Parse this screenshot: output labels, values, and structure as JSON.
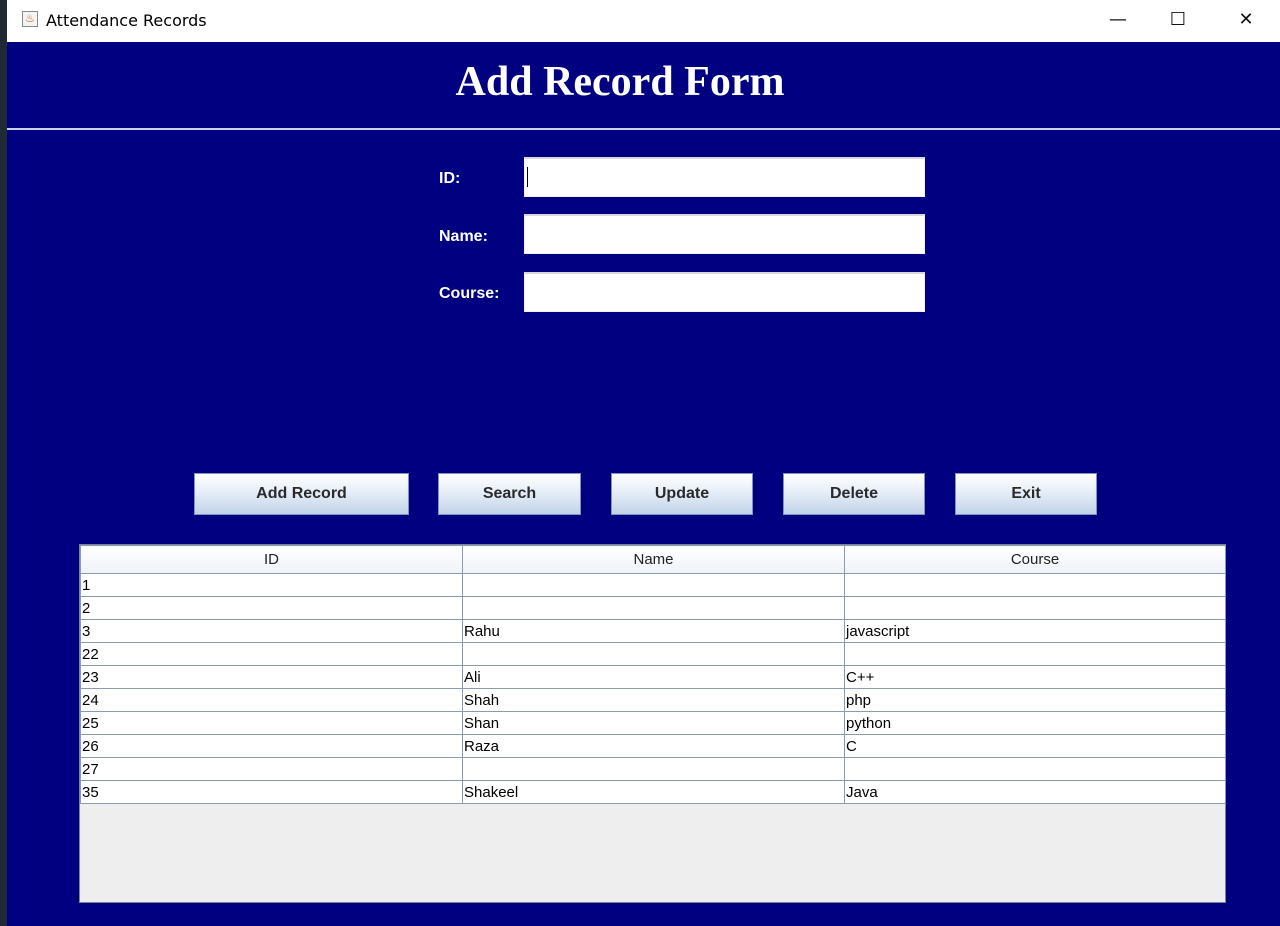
{
  "window": {
    "title": "Attendance Records",
    "controls": {
      "minimize": "—",
      "maximize": "☐",
      "close": "✕"
    }
  },
  "form": {
    "title": "Add Record Form",
    "fields": [
      {
        "label": "ID:",
        "value": ""
      },
      {
        "label": "Name:",
        "value": ""
      },
      {
        "label": "Course:",
        "value": ""
      }
    ]
  },
  "buttons": {
    "add": "Add Record",
    "search": "Search",
    "update": "Update",
    "delete": "Delete",
    "exit": "Exit"
  },
  "table": {
    "columns": [
      "ID",
      "Name",
      "Course"
    ],
    "rows": [
      [
        "1",
        "",
        ""
      ],
      [
        "2",
        "",
        ""
      ],
      [
        "3",
        "Rahu",
        "javascript"
      ],
      [
        "22",
        "",
        ""
      ],
      [
        "23",
        "Ali",
        "C++"
      ],
      [
        "24",
        "Shah",
        "php"
      ],
      [
        "25",
        "Shan",
        "python"
      ],
      [
        "26",
        "Raza",
        "C"
      ],
      [
        "27",
        "",
        ""
      ],
      [
        "35",
        "Shakeel",
        "Java"
      ]
    ]
  },
  "colors": {
    "background": "#000080",
    "title_text": "#ffffff"
  }
}
